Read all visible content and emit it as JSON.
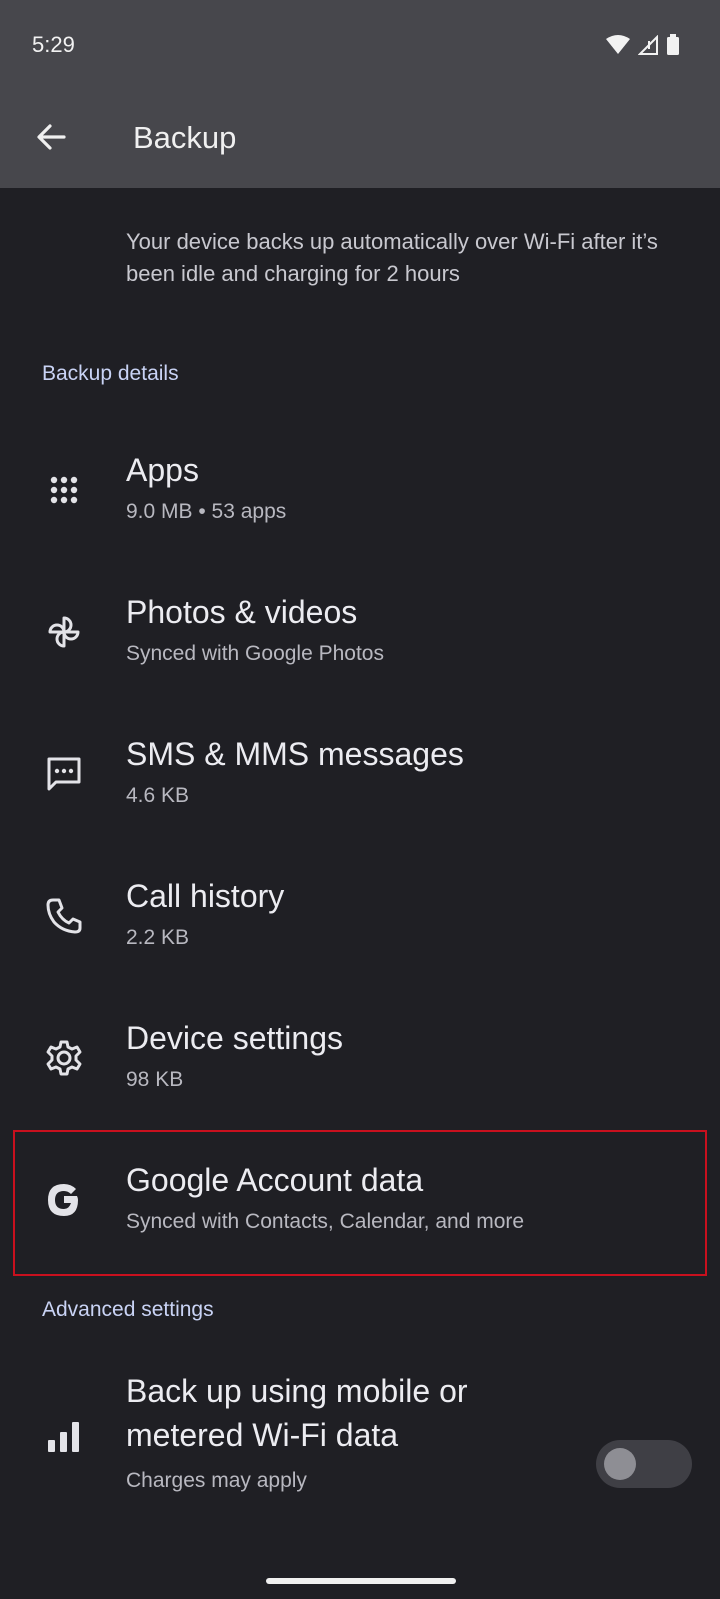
{
  "status_bar": {
    "time": "5:29"
  },
  "app_bar": {
    "title": "Backup"
  },
  "intro_text": "Your device backs up automatically over Wi-Fi after it’s been idle and charging for 2 hours",
  "sections": {
    "backup_details": "Backup details",
    "advanced_settings": "Advanced settings"
  },
  "items": [
    {
      "title": "Apps",
      "subtitle": "9.0 MB • 53 apps",
      "icon": "apps-grid-icon"
    },
    {
      "title": "Photos & videos",
      "subtitle": "Synced with Google Photos",
      "icon": "pinwheel-icon"
    },
    {
      "title": "SMS & MMS messages",
      "subtitle": "4.6 KB",
      "icon": "message-icon"
    },
    {
      "title": "Call history",
      "subtitle": "2.2 KB",
      "icon": "phone-icon"
    },
    {
      "title": "Device settings",
      "subtitle": "98 KB",
      "icon": "gear-icon"
    },
    {
      "title": "Google Account data",
      "subtitle": "Synced with Contacts, Calendar, and more",
      "icon": "google-g-icon"
    }
  ],
  "advanced": {
    "title_line1": "Back up using mobile or",
    "title_line2": "metered Wi-Fi data",
    "subtitle": "Charges may apply",
    "icon": "signal-bars-icon",
    "toggle_on": false
  },
  "colors": {
    "background": "#1f1f24",
    "app_bar": "#47474c",
    "section_header": "#c9d3f5",
    "highlight_border": "#c8101e"
  }
}
